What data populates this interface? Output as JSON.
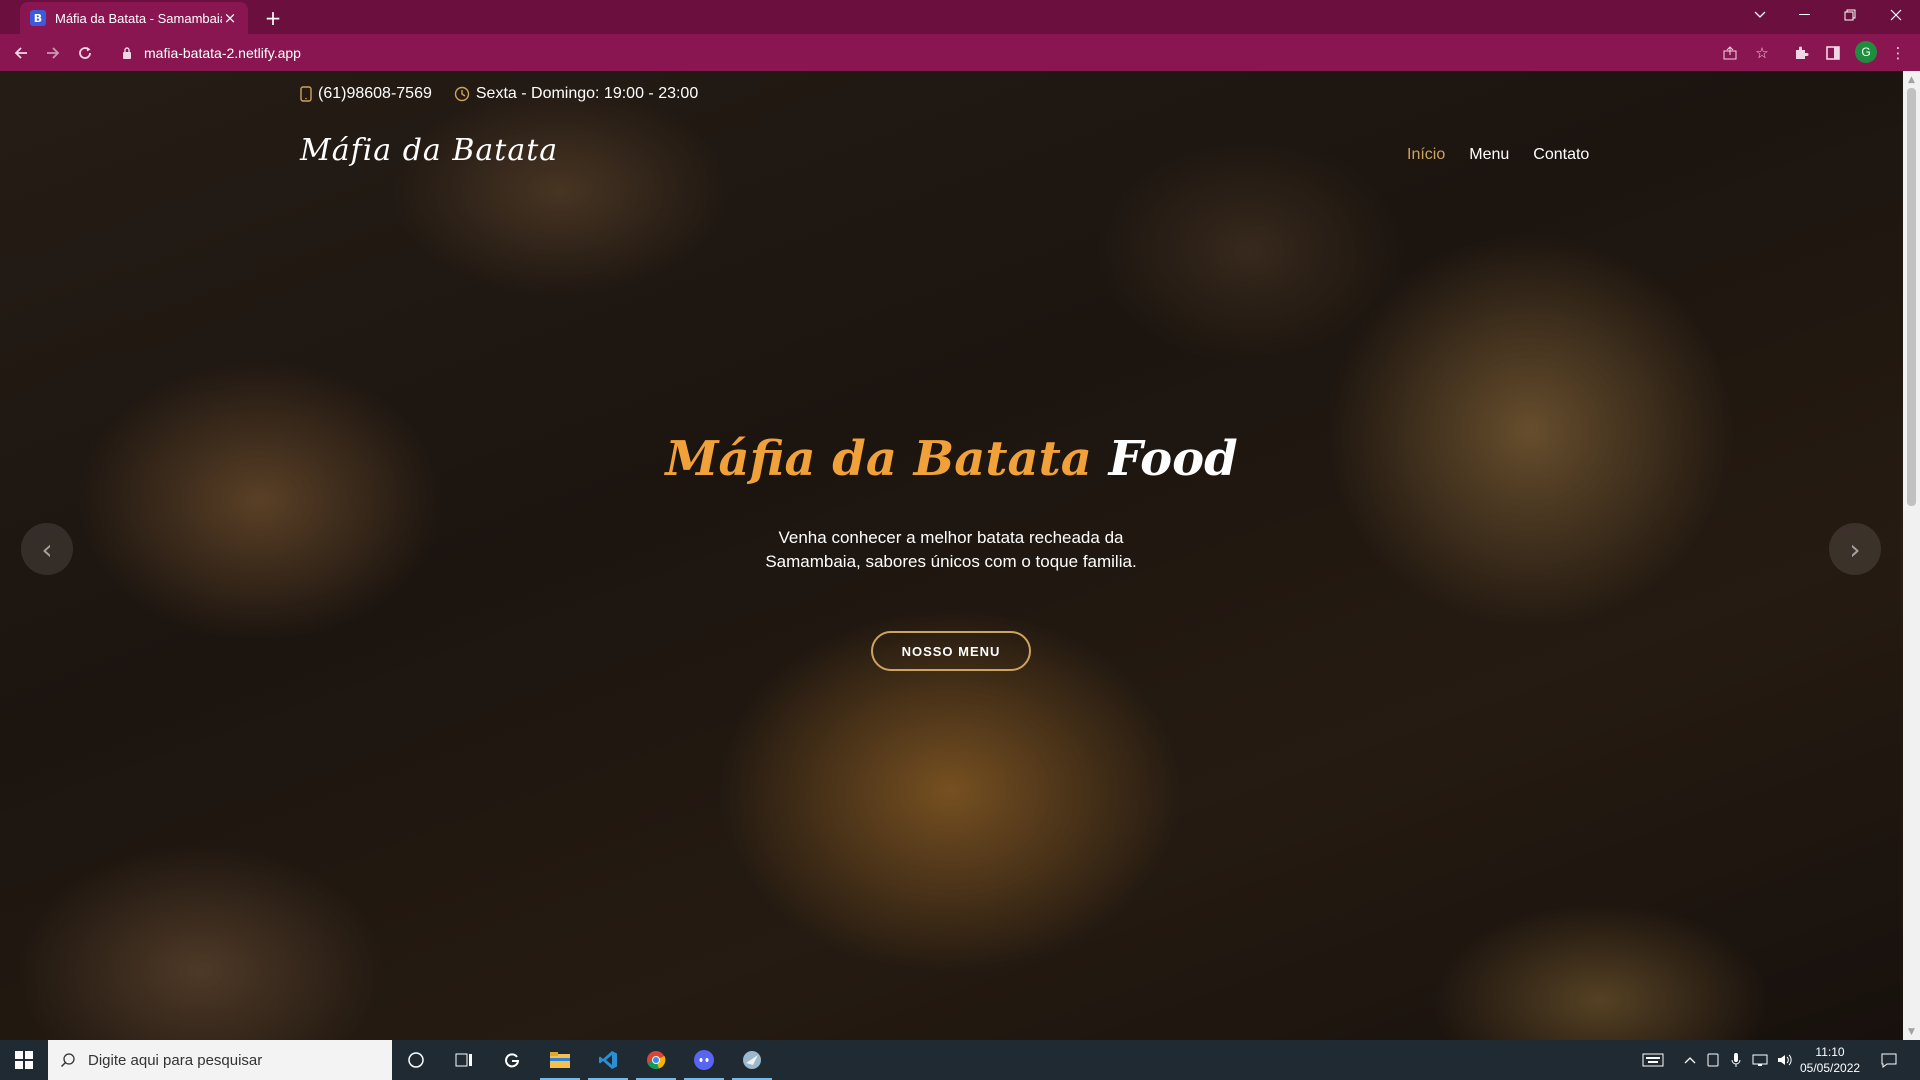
{
  "browser": {
    "tab": {
      "favicon": "B",
      "title": "Máfia da Batata - Samambaia",
      "close": "×"
    },
    "new_tab": "+",
    "url": "mafia-batata-2.netlify.app",
    "profile_initial": "G"
  },
  "site": {
    "topbar": {
      "phone": "(61)98608-7569",
      "hours": "Sexta - Domingo: 19:00 - 23:00"
    },
    "brand": "Máfia da Batata",
    "nav": [
      {
        "label": "Início",
        "active": true
      },
      {
        "label": "Menu",
        "active": false
      },
      {
        "label": "Contato",
        "active": false
      }
    ],
    "hero": {
      "title_accent": "Máfia da Batata",
      "title_rest": "Food",
      "text": "Venha conhecer a melhor batata recheada da Samambaia, sabores únicos com o toque familia.",
      "button": "NOSSO MENU"
    },
    "accent_color": "#cda45e"
  },
  "taskbar": {
    "search_placeholder": "Digite aqui para pesquisar",
    "time": "11:10",
    "date": "05/05/2022"
  }
}
